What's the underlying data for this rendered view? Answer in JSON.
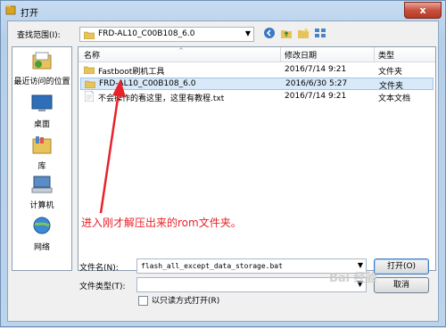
{
  "window": {
    "title": "打开",
    "close_label": "x"
  },
  "toolbar": {
    "lookin_label": "查找范围(I):",
    "lookin_value": "FRD-AL10_C00B108_6.0"
  },
  "places": [
    {
      "label": "最近访问的位置"
    },
    {
      "label": "桌面"
    },
    {
      "label": "库"
    },
    {
      "label": "计算机"
    },
    {
      "label": "网络"
    }
  ],
  "columns": {
    "name": "名称",
    "date": "修改日期",
    "type": "类型"
  },
  "files": [
    {
      "name": "Fastboot刷机工具",
      "date": "2016/7/14 9:21",
      "type": "文件夹"
    },
    {
      "name": "FRD-AL10_C00B108_6.0",
      "date": "2016/6/30 5:27",
      "type": "文件夹"
    },
    {
      "name": "不会操作的看这里，这里有教程.txt",
      "date": "2016/7/14 9:21",
      "type": "文本文档"
    }
  ],
  "form": {
    "filename_label": "文件名(N):",
    "filename_value": "flash_all_except_data_storage.bat",
    "filetype_label": "文件类型(T):",
    "filetype_value": "",
    "readonly_label": "以只读方式打开(R)",
    "open_label": "打开(O)",
    "cancel_label": "取消"
  },
  "annotation": {
    "text": "进入刚才解压出来的rom文件夹。",
    "color": "#e8212a"
  },
  "watermark": {
    "text": "Bai 经验"
  }
}
